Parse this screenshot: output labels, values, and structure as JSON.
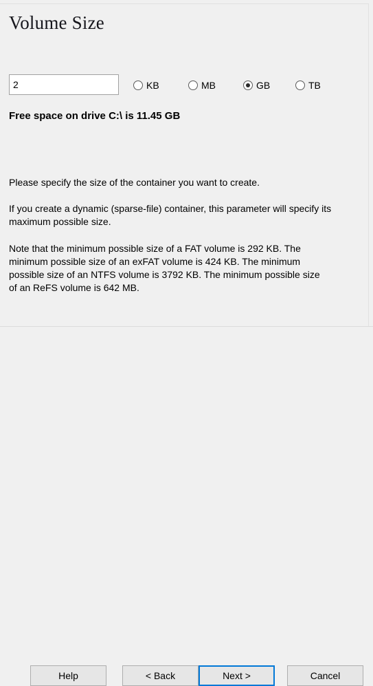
{
  "window": {
    "title": "Volume Size"
  },
  "size": {
    "value": "2",
    "placeholder": "",
    "units": [
      {
        "id": "kb",
        "label": "KB",
        "selected": false
      },
      {
        "id": "mb",
        "label": "MB",
        "selected": false
      },
      {
        "id": "gb",
        "label": "GB",
        "selected": true
      },
      {
        "id": "tb",
        "label": "TB",
        "selected": false
      }
    ],
    "free_space": "Free space on drive C:\\ is 11.45 GB"
  },
  "description": {
    "specify": "Please specify the size of the container you want to create.",
    "dynamic": "If you create a dynamic (sparse-file) container, this parameter will specify its maximum possible size.",
    "note": "Note that the minimum possible size of a FAT volume is 292 KB. The minimum possible size of an exFAT volume is 424 KB. The minimum possible size of an NTFS volume is 3792 KB. The minimum possible size of an ReFS volume is 642 MB."
  },
  "buttons": {
    "help": "Help",
    "back": "< Back",
    "next": "Next >",
    "cancel": "Cancel"
  },
  "colors": {
    "background": "#f0f0f0",
    "focus_border": "#0078d7",
    "button_face": "#e6e6e6",
    "button_border": "#adadad",
    "field_border": "#a0a0a0"
  }
}
